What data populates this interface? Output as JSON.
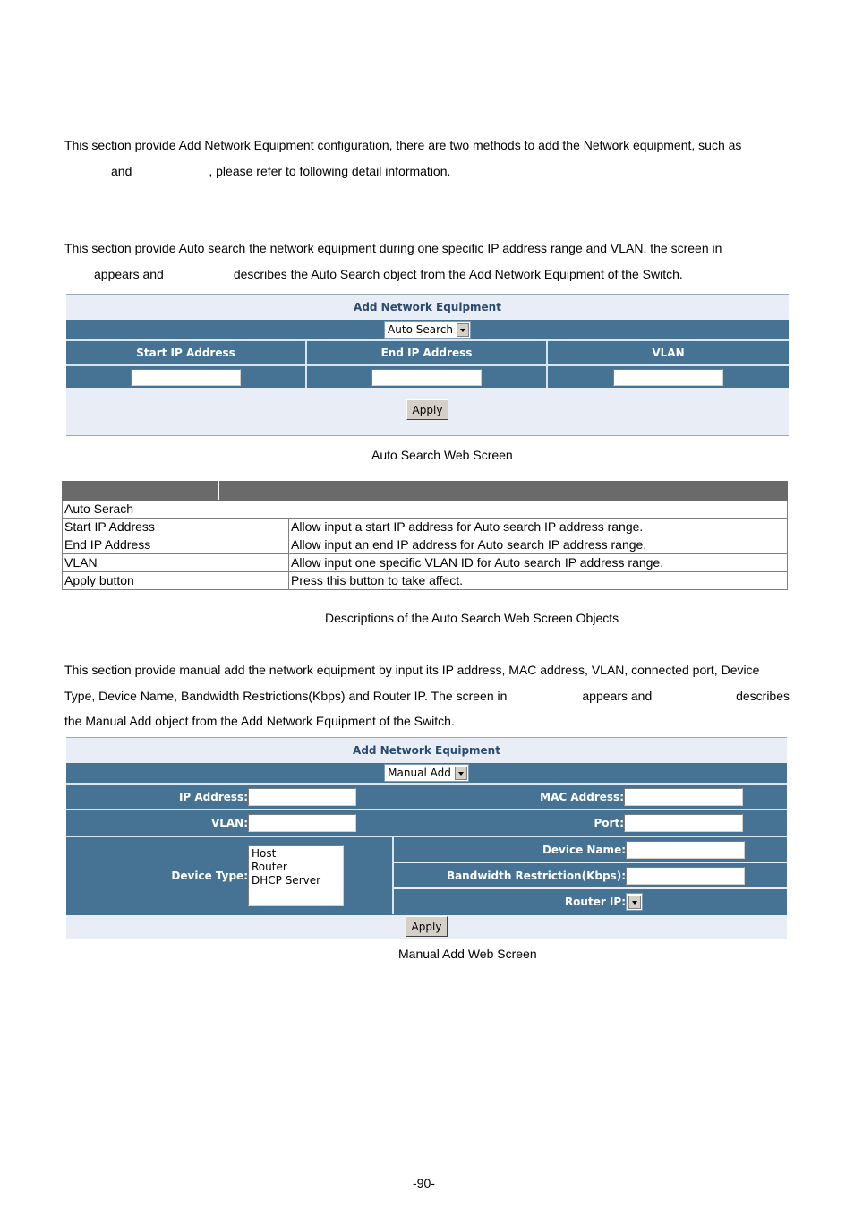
{
  "intro": {
    "line1": "This section provide Add Network Equipment configuration, there are two methods to add the Network equipment, such as",
    "line2_a": "and",
    "line2_b": ", please refer to following detail information."
  },
  "auto_intro": {
    "line1": "This section provide Auto search the network equipment during one specific IP address range and VLAN, the screen in",
    "line2_a": "appears and",
    "line2_b": "describes the Auto Search object from the Add Network Equipment of the Switch."
  },
  "auto_screen": {
    "title": "Add Network Equipment",
    "mode_selected": "Auto Search",
    "columns": [
      "Start IP Address",
      "End IP Address",
      "VLAN"
    ],
    "values": [
      "",
      "",
      ""
    ],
    "apply_label": "Apply",
    "caption": "Auto Search Web Screen"
  },
  "auto_desc": {
    "headers": [
      "",
      ""
    ],
    "group": "Auto Serach",
    "rows": [
      {
        "object": "Start IP Address",
        "description": "Allow input a start IP address for Auto search IP address range."
      },
      {
        "object": "End IP Address",
        "description": "Allow input an end IP address for Auto search IP address range."
      },
      {
        "object": "VLAN",
        "description": "Allow input one specific VLAN ID for Auto search IP address range."
      },
      {
        "object": "Apply button",
        "description": "Press this button to take affect."
      }
    ],
    "caption": "Descriptions of the Auto Search Web Screen Objects"
  },
  "manual_intro": {
    "line1": "This section provide manual add the network equipment by input its IP address, MAC address, VLAN, connected port, Device",
    "line2_a": "Type, Device Name, Bandwidth Restrictions(Kbps) and Router IP. The screen in",
    "line2_b": "appears and",
    "line2_c": "describes",
    "line3": "the Manual Add object from the Add Network Equipment of the Switch."
  },
  "manual_screen": {
    "title": "Add Network Equipment",
    "mode_selected": "Manual Add",
    "labels": {
      "ip": "IP Address:",
      "mac": "MAC Address:",
      "vlan": "VLAN:",
      "port": "Port:",
      "device_type": "Device Type:",
      "device_name": "Device Name:",
      "bandwidth": "Bandwidth Restriction(Kbps):",
      "router_ip": "Router IP:"
    },
    "device_type_options": [
      "Host",
      "Router",
      "DHCP Server"
    ],
    "apply_label": "Apply",
    "caption": "Manual Add Web Screen"
  },
  "page_number": "-90-"
}
